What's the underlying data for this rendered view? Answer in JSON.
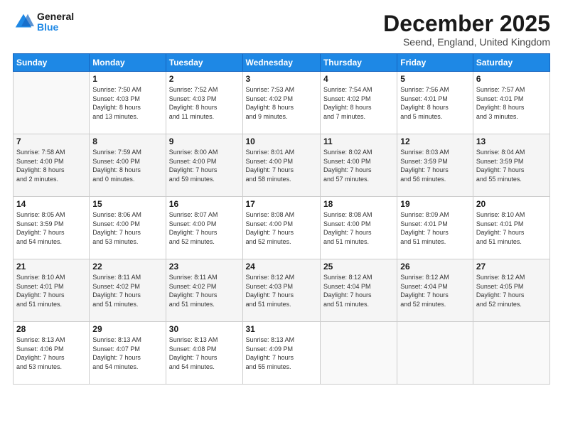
{
  "logo": {
    "line1": "General",
    "line2": "Blue"
  },
  "header": {
    "month": "December 2025",
    "location": "Seend, England, United Kingdom"
  },
  "days_of_week": [
    "Sunday",
    "Monday",
    "Tuesday",
    "Wednesday",
    "Thursday",
    "Friday",
    "Saturday"
  ],
  "weeks": [
    [
      {
        "day": "",
        "info": ""
      },
      {
        "day": "1",
        "info": "Sunrise: 7:50 AM\nSunset: 4:03 PM\nDaylight: 8 hours\nand 13 minutes."
      },
      {
        "day": "2",
        "info": "Sunrise: 7:52 AM\nSunset: 4:03 PM\nDaylight: 8 hours\nand 11 minutes."
      },
      {
        "day": "3",
        "info": "Sunrise: 7:53 AM\nSunset: 4:02 PM\nDaylight: 8 hours\nand 9 minutes."
      },
      {
        "day": "4",
        "info": "Sunrise: 7:54 AM\nSunset: 4:02 PM\nDaylight: 8 hours\nand 7 minutes."
      },
      {
        "day": "5",
        "info": "Sunrise: 7:56 AM\nSunset: 4:01 PM\nDaylight: 8 hours\nand 5 minutes."
      },
      {
        "day": "6",
        "info": "Sunrise: 7:57 AM\nSunset: 4:01 PM\nDaylight: 8 hours\nand 3 minutes."
      }
    ],
    [
      {
        "day": "7",
        "info": "Sunrise: 7:58 AM\nSunset: 4:00 PM\nDaylight: 8 hours\nand 2 minutes."
      },
      {
        "day": "8",
        "info": "Sunrise: 7:59 AM\nSunset: 4:00 PM\nDaylight: 8 hours\nand 0 minutes."
      },
      {
        "day": "9",
        "info": "Sunrise: 8:00 AM\nSunset: 4:00 PM\nDaylight: 7 hours\nand 59 minutes."
      },
      {
        "day": "10",
        "info": "Sunrise: 8:01 AM\nSunset: 4:00 PM\nDaylight: 7 hours\nand 58 minutes."
      },
      {
        "day": "11",
        "info": "Sunrise: 8:02 AM\nSunset: 4:00 PM\nDaylight: 7 hours\nand 57 minutes."
      },
      {
        "day": "12",
        "info": "Sunrise: 8:03 AM\nSunset: 3:59 PM\nDaylight: 7 hours\nand 56 minutes."
      },
      {
        "day": "13",
        "info": "Sunrise: 8:04 AM\nSunset: 3:59 PM\nDaylight: 7 hours\nand 55 minutes."
      }
    ],
    [
      {
        "day": "14",
        "info": "Sunrise: 8:05 AM\nSunset: 3:59 PM\nDaylight: 7 hours\nand 54 minutes."
      },
      {
        "day": "15",
        "info": "Sunrise: 8:06 AM\nSunset: 4:00 PM\nDaylight: 7 hours\nand 53 minutes."
      },
      {
        "day": "16",
        "info": "Sunrise: 8:07 AM\nSunset: 4:00 PM\nDaylight: 7 hours\nand 52 minutes."
      },
      {
        "day": "17",
        "info": "Sunrise: 8:08 AM\nSunset: 4:00 PM\nDaylight: 7 hours\nand 52 minutes."
      },
      {
        "day": "18",
        "info": "Sunrise: 8:08 AM\nSunset: 4:00 PM\nDaylight: 7 hours\nand 51 minutes."
      },
      {
        "day": "19",
        "info": "Sunrise: 8:09 AM\nSunset: 4:01 PM\nDaylight: 7 hours\nand 51 minutes."
      },
      {
        "day": "20",
        "info": "Sunrise: 8:10 AM\nSunset: 4:01 PM\nDaylight: 7 hours\nand 51 minutes."
      }
    ],
    [
      {
        "day": "21",
        "info": "Sunrise: 8:10 AM\nSunset: 4:01 PM\nDaylight: 7 hours\nand 51 minutes."
      },
      {
        "day": "22",
        "info": "Sunrise: 8:11 AM\nSunset: 4:02 PM\nDaylight: 7 hours\nand 51 minutes."
      },
      {
        "day": "23",
        "info": "Sunrise: 8:11 AM\nSunset: 4:02 PM\nDaylight: 7 hours\nand 51 minutes."
      },
      {
        "day": "24",
        "info": "Sunrise: 8:12 AM\nSunset: 4:03 PM\nDaylight: 7 hours\nand 51 minutes."
      },
      {
        "day": "25",
        "info": "Sunrise: 8:12 AM\nSunset: 4:04 PM\nDaylight: 7 hours\nand 51 minutes."
      },
      {
        "day": "26",
        "info": "Sunrise: 8:12 AM\nSunset: 4:04 PM\nDaylight: 7 hours\nand 52 minutes."
      },
      {
        "day": "27",
        "info": "Sunrise: 8:12 AM\nSunset: 4:05 PM\nDaylight: 7 hours\nand 52 minutes."
      }
    ],
    [
      {
        "day": "28",
        "info": "Sunrise: 8:13 AM\nSunset: 4:06 PM\nDaylight: 7 hours\nand 53 minutes."
      },
      {
        "day": "29",
        "info": "Sunrise: 8:13 AM\nSunset: 4:07 PM\nDaylight: 7 hours\nand 54 minutes."
      },
      {
        "day": "30",
        "info": "Sunrise: 8:13 AM\nSunset: 4:08 PM\nDaylight: 7 hours\nand 54 minutes."
      },
      {
        "day": "31",
        "info": "Sunrise: 8:13 AM\nSunset: 4:09 PM\nDaylight: 7 hours\nand 55 minutes."
      },
      {
        "day": "",
        "info": ""
      },
      {
        "day": "",
        "info": ""
      },
      {
        "day": "",
        "info": ""
      }
    ]
  ]
}
